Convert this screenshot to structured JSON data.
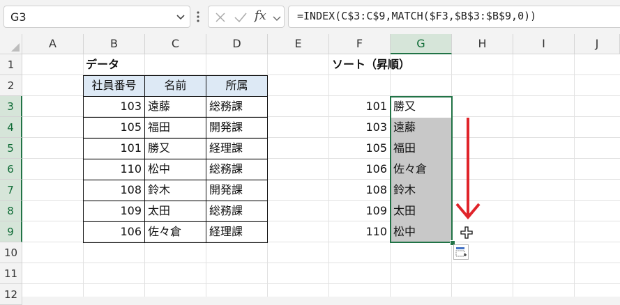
{
  "formula_bar": {
    "name_box": "G3",
    "fx_label": "fx",
    "formula": "=INDEX(C$3:C$9,MATCH($F3,$B$3:$B$9,0))"
  },
  "columns": [
    "A",
    "B",
    "C",
    "D",
    "E",
    "F",
    "G",
    "H",
    "I",
    "J"
  ],
  "rows": [
    "1",
    "2",
    "3",
    "4",
    "5",
    "6",
    "7",
    "8",
    "9",
    "10",
    "11",
    "12"
  ],
  "selected_column": "G",
  "selected_rows": [
    "3",
    "4",
    "5",
    "6",
    "7",
    "8",
    "9"
  ],
  "data_title": "データ",
  "data_table": {
    "headers": [
      "社員番号",
      "名前",
      "所属"
    ],
    "rows": [
      [
        "103",
        "遠藤",
        "総務課"
      ],
      [
        "105",
        "福田",
        "開発課"
      ],
      [
        "101",
        "勝又",
        "経理課"
      ],
      [
        "110",
        "松中",
        "総務課"
      ],
      [
        "108",
        "鈴木",
        "開発課"
      ],
      [
        "109",
        "太田",
        "総務課"
      ],
      [
        "106",
        "佐々倉",
        "経理課"
      ]
    ]
  },
  "sort_title": "ソート（昇順）",
  "sort_table": {
    "rows": [
      [
        "101",
        "勝又"
      ],
      [
        "103",
        "遠藤"
      ],
      [
        "105",
        "福田"
      ],
      [
        "106",
        "佐々倉"
      ],
      [
        "108",
        "鈴木"
      ],
      [
        "109",
        "太田"
      ],
      [
        "110",
        "松中"
      ]
    ]
  },
  "colors": {
    "accent": "#217346",
    "header_fill": "#dde9f5",
    "selection": "#c8c8c8",
    "arrow": "#e0242a"
  },
  "icons": [
    "chevron-down-icon",
    "more-options-icon",
    "cancel-icon",
    "enter-icon",
    "fill-cursor-icon",
    "quick-analysis-icon",
    "down-arrow-annotation"
  ]
}
